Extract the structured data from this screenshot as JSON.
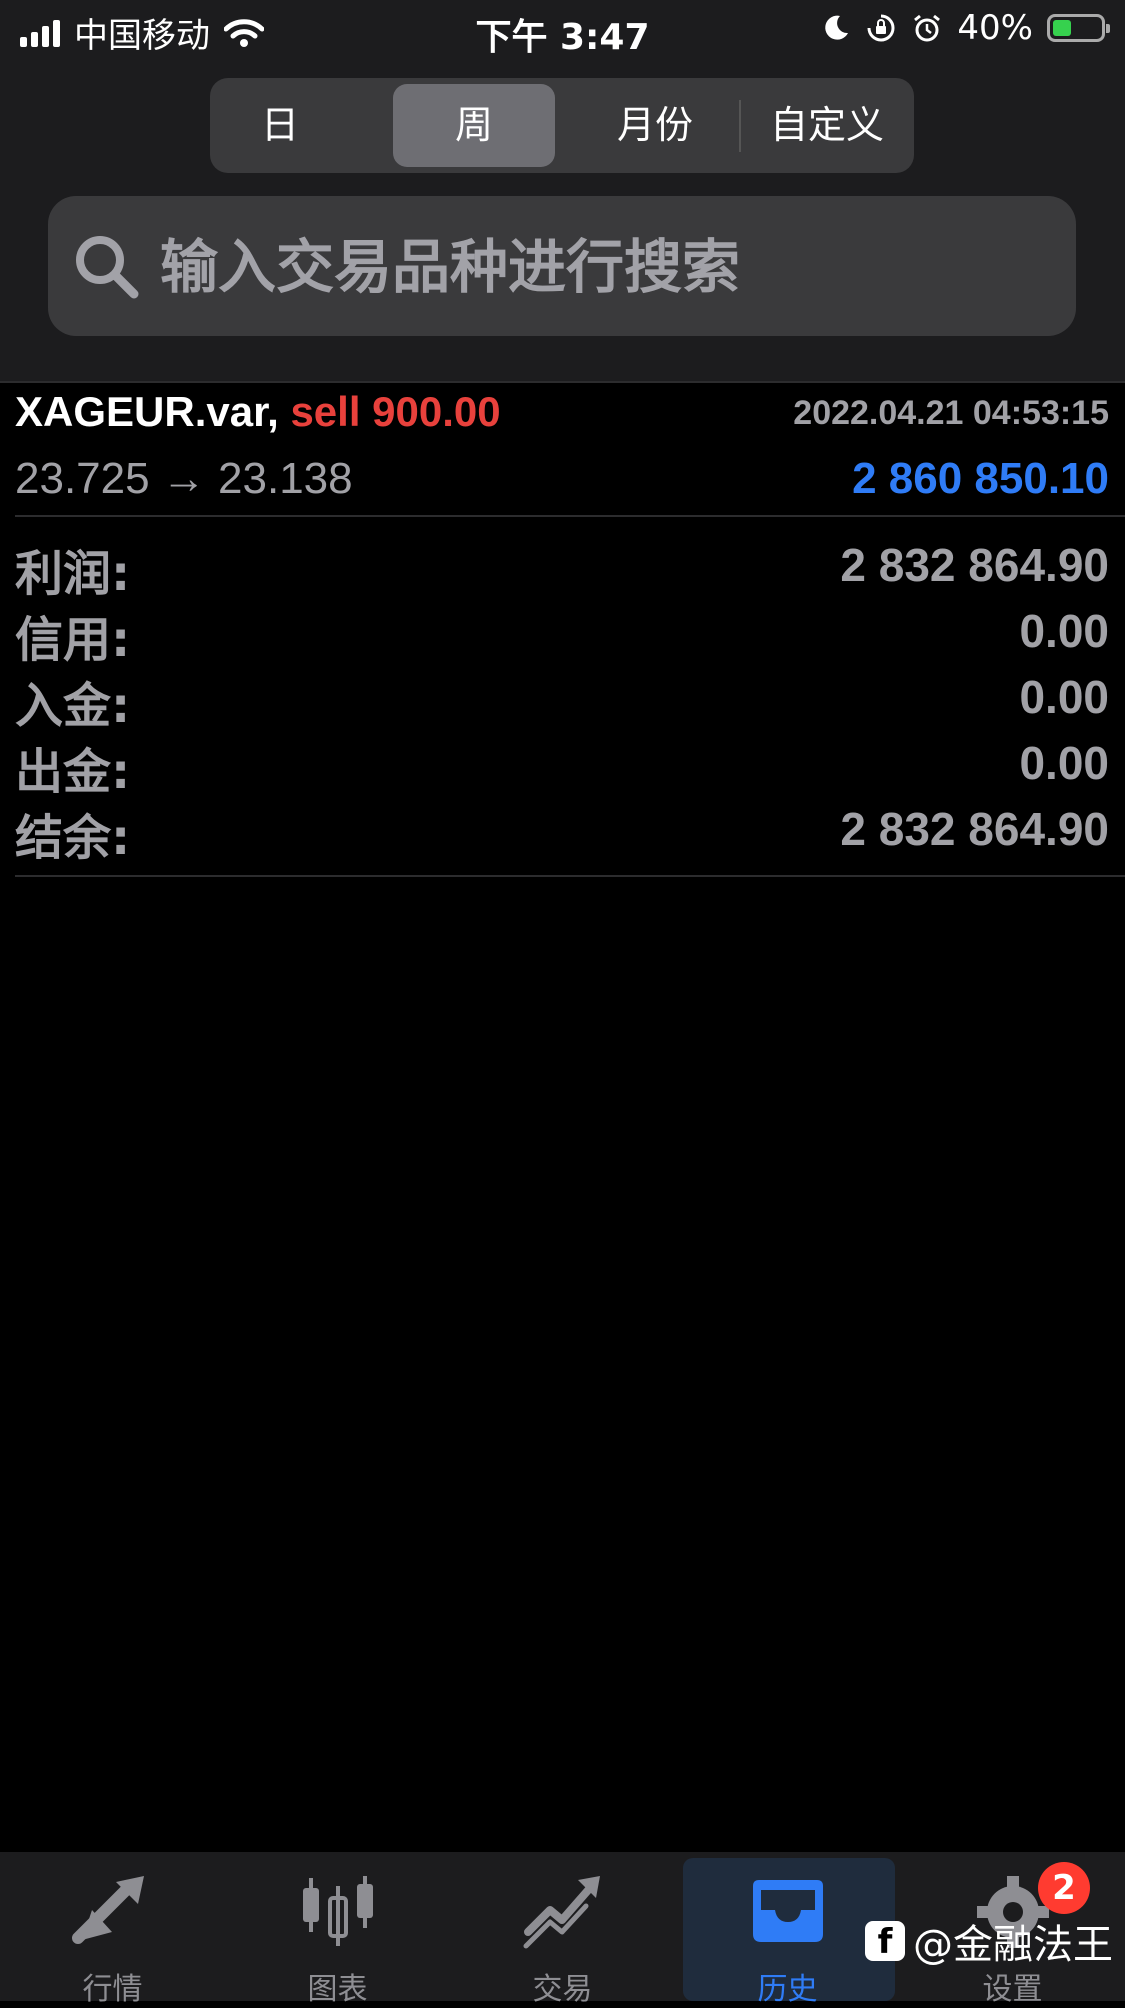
{
  "status_bar": {
    "carrier": "中国移动",
    "time": "下午 3:47",
    "battery": "40%",
    "battery_level": 0.4
  },
  "tabs": {
    "day": "日",
    "week": "周",
    "month": "月份",
    "custom": "自定义",
    "selected": "周"
  },
  "search": {
    "placeholder": "输入交易品种进行搜索"
  },
  "trade": {
    "symbol": "XAGEUR.var,",
    "side_volume": "sell 900.00",
    "datetime": "2022.04.21 04:53:15",
    "prices": "23.725 → 23.138",
    "profit": "2 860 850.10"
  },
  "summary": {
    "profit_label": "利润:",
    "profit_value": "2 832 864.90",
    "credit_label": "信用:",
    "credit_value": "0.00",
    "deposit_label": "入金:",
    "deposit_value": "0.00",
    "withdrawal_label": "出金:",
    "withdrawal_value": "0.00",
    "balance_label": "结余:",
    "balance_value": "2 832 864.90"
  },
  "tab_bar": {
    "quotes": "行情",
    "charts": "图表",
    "trade": "交易",
    "history": "历史",
    "settings": "设置",
    "settings_badge": "2",
    "active": "历史"
  },
  "watermark": "@金融法王",
  "colors": {
    "sell": "#e8413c",
    "profit": "#2f7cf6",
    "accent": "#2f7cf6",
    "badge": "#ff3b30"
  }
}
